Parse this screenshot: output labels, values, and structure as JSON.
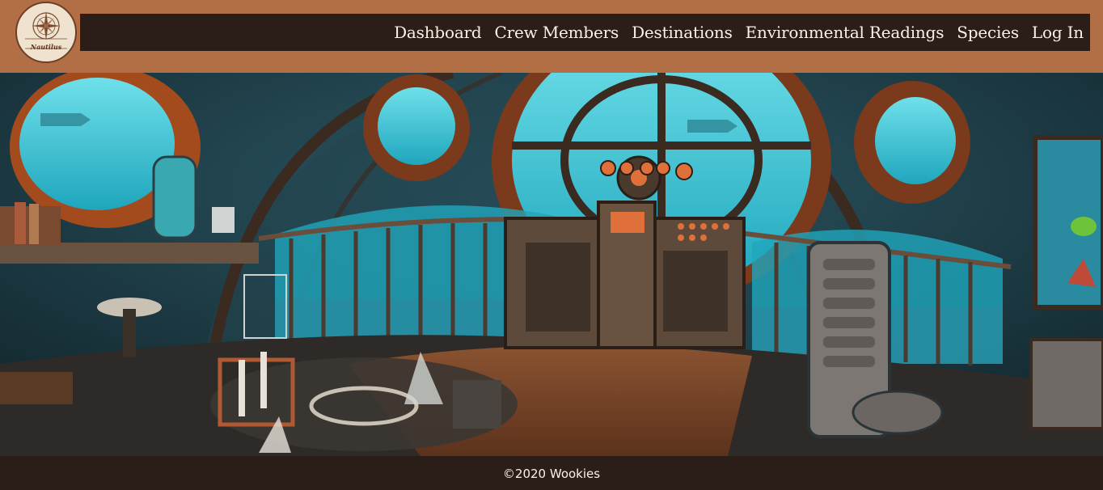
{
  "logo": {
    "text": "Nautilus"
  },
  "nav": {
    "items": [
      {
        "label": "Dashboard"
      },
      {
        "label": "Crew Members"
      },
      {
        "label": "Destinations"
      },
      {
        "label": "Environmental Readings"
      },
      {
        "label": "Species"
      },
      {
        "label": "Log In"
      }
    ]
  },
  "footer": {
    "copyright": "©2020 Wookies"
  },
  "colors": {
    "header": "#b26e45",
    "nav_bg": "#2b1d17",
    "nav_text": "#fbf2e6",
    "water": "#3cc2d2"
  }
}
